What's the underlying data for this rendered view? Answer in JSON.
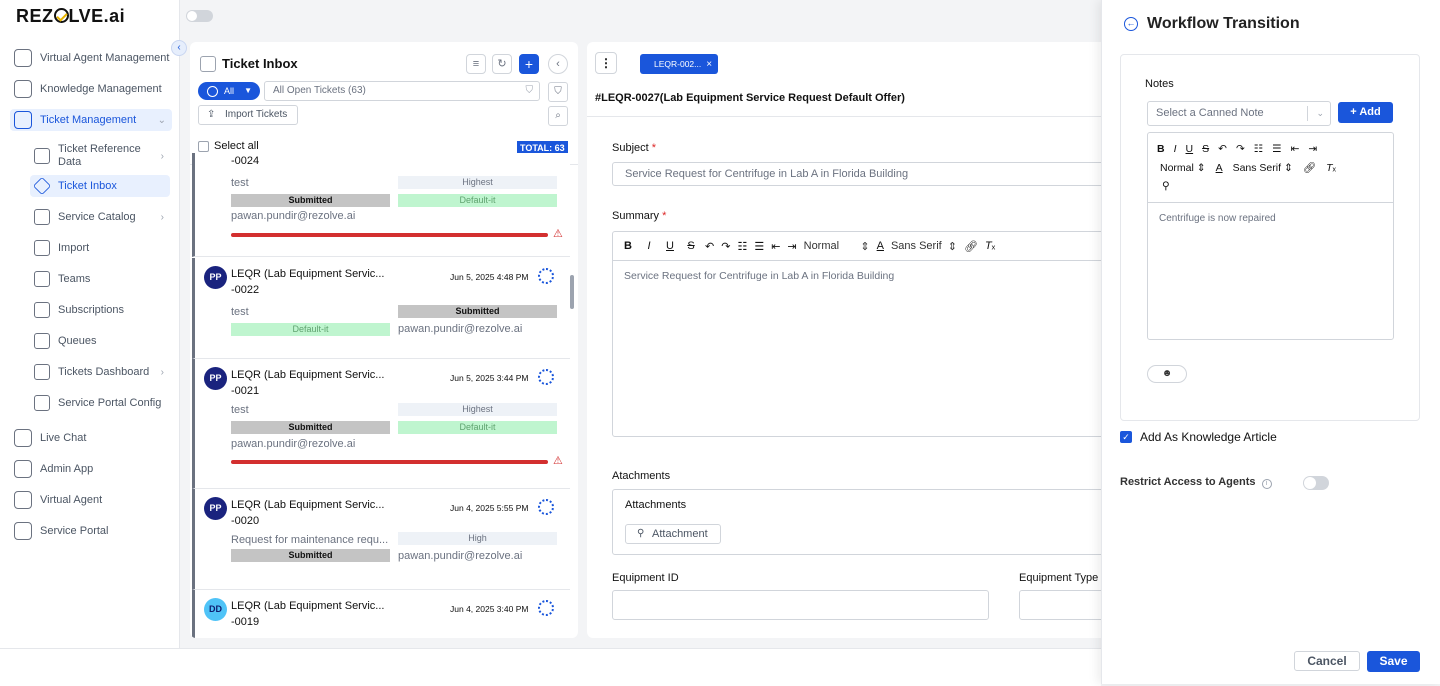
{
  "brand": {
    "logo_prefix": "REZ",
    "logo_suffix": "LVE.ai"
  },
  "sidebar": {
    "items": [
      {
        "label": "Virtual Agent Management",
        "icon": "agent-icon"
      },
      {
        "label": "Knowledge Management",
        "icon": "book-icon"
      },
      {
        "label": "Ticket Management",
        "icon": "ticket-icon",
        "active": true
      }
    ],
    "sub_items": [
      {
        "label": "Ticket Reference Data",
        "icon": "table-icon"
      },
      {
        "label": "Ticket Inbox",
        "icon": "tag-icon",
        "active": true
      },
      {
        "label": "Service Catalog",
        "icon": "wrench-icon"
      },
      {
        "label": "Import",
        "icon": "import-icon"
      },
      {
        "label": "Teams",
        "icon": "teams-icon"
      },
      {
        "label": "Subscriptions",
        "icon": "subscriptions-icon"
      },
      {
        "label": "Queues",
        "icon": "queues-icon"
      },
      {
        "label": "Tickets Dashboard",
        "icon": "dashboard-icon"
      },
      {
        "label": "Service Portal Config",
        "icon": "config-icon"
      }
    ],
    "bottom_items": [
      {
        "label": "Live Chat",
        "icon": "chat-icon"
      },
      {
        "label": "Admin App",
        "icon": "sliders-icon"
      },
      {
        "label": "Virtual Agent",
        "icon": "bot-icon"
      },
      {
        "label": "Service Portal",
        "icon": "portal-icon"
      }
    ]
  },
  "inbox": {
    "title": "Ticket Inbox",
    "filter_all": "All",
    "filter_view": "All Open Tickets",
    "filter_count": "(63)",
    "import_label": "Import Tickets",
    "select_all": "Select all",
    "total": "TOTAL: 63",
    "cards": [
      {
        "title_line2": "-0024",
        "desc": "test",
        "status": "Submitted",
        "priority": "Highest",
        "group": "Default-it",
        "email": "pawan.pundir@rezolve.ai"
      },
      {
        "avatar": "PP",
        "title_line1": "LEQR (Lab Equipment Servic...",
        "title_line2": "-0022",
        "date": "Jun 5, 2025 4:48 PM",
        "desc": "test",
        "status": "Submitted",
        "group": "Default-it",
        "email": "pawan.pundir@rezolve.ai"
      },
      {
        "avatar": "PP",
        "title_line1": "LEQR (Lab Equipment Servic...",
        "title_line2": "-0021",
        "date": "Jun 5, 2025 3:44 PM",
        "desc": "test",
        "status": "Submitted",
        "priority": "Highest",
        "group": "Default-it",
        "email": "pawan.pundir@rezolve.ai"
      },
      {
        "avatar": "PP",
        "title_line1": "LEQR (Lab Equipment Servic...",
        "title_line2": "-0020",
        "date": "Jun 4, 2025 5:55 PM",
        "desc": "Request for maintenance requ...",
        "status": "Submitted",
        "priority": "High",
        "email": "pawan.pundir@rezolve.ai"
      },
      {
        "avatar": "DD",
        "title_line1": "LEQR (Lab Equipment Servic...",
        "title_line2": "-0019",
        "date": "Jun 4, 2025 3:40 PM"
      }
    ]
  },
  "ticket": {
    "tab_label": "LEQR-002...",
    "heading": "#LEQR-0027(Lab Equipment Service Request Default Offer)",
    "subject_label": "Subject",
    "subject_value": "Service Request for Centrifuge in Lab A in Florida Building",
    "summary_label": "Summary",
    "summary_value": "Service Request for Centrifuge in Lab A in Florida Building",
    "size_option": "Normal",
    "font_option": "Sans Serif",
    "attachments_section": "Atachments",
    "attachments_label": "Attachments",
    "attachment_button": "Attachment",
    "equipment_id_label": "Equipment ID",
    "equipment_type_label": "Equipment Type"
  },
  "modal": {
    "title": "Workflow Transition",
    "notes_label": "Notes",
    "canned_placeholder": "Select a Canned Note",
    "add_label": "+ Add",
    "size_option": "Normal",
    "font_option": "Sans Serif",
    "note_text": "Centrifuge is now repaired",
    "kb_label": "Add As Knowledge Article",
    "kb_checked": true,
    "restrict_label": "Restrict Access to Agents",
    "restrict_on": false,
    "cancel_label": "Cancel",
    "save_label": "Save"
  },
  "colors": {
    "accent": "#1a56db",
    "sla_breach": "#d32f2f",
    "group_chip": "#bff5cf"
  }
}
